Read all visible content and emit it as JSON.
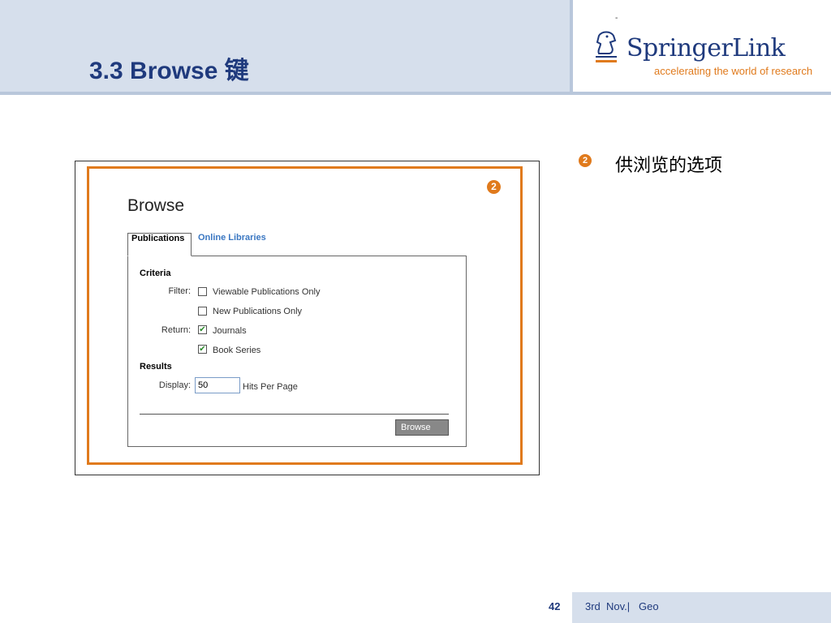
{
  "header": {
    "title": "3.3 Browse 键",
    "logo_dash": "-",
    "logo_name": "SpringerLink",
    "logo_tagline": "accelerating the world of research"
  },
  "screenshot": {
    "marker": "2",
    "heading": "Browse",
    "tabs": [
      "Publications",
      "Online Libraries"
    ],
    "criteria_label": "Criteria",
    "filter_label": "Filter:",
    "filter_options": [
      {
        "label": "Viewable Publications Only",
        "checked": false
      },
      {
        "label": "New Publications Only",
        "checked": false
      }
    ],
    "return_label": "Return:",
    "return_options": [
      {
        "label": "Journals",
        "checked": true
      },
      {
        "label": "Book Series",
        "checked": true
      }
    ],
    "results_label": "Results",
    "display_label": "Display:",
    "display_value": "50",
    "hits_label": "Hits Per Page",
    "browse_button": "Browse"
  },
  "bullet": {
    "marker": "2",
    "text": "供浏览的选项"
  },
  "footer": {
    "page_number": "42",
    "text": "3rd  Nov.|   Geo"
  },
  "colors": {
    "accent_orange": "#e07a1c",
    "title_blue": "#1f3a7d",
    "band_blue": "#d6dfec",
    "checkmark_green": "#2a8a2a"
  }
}
